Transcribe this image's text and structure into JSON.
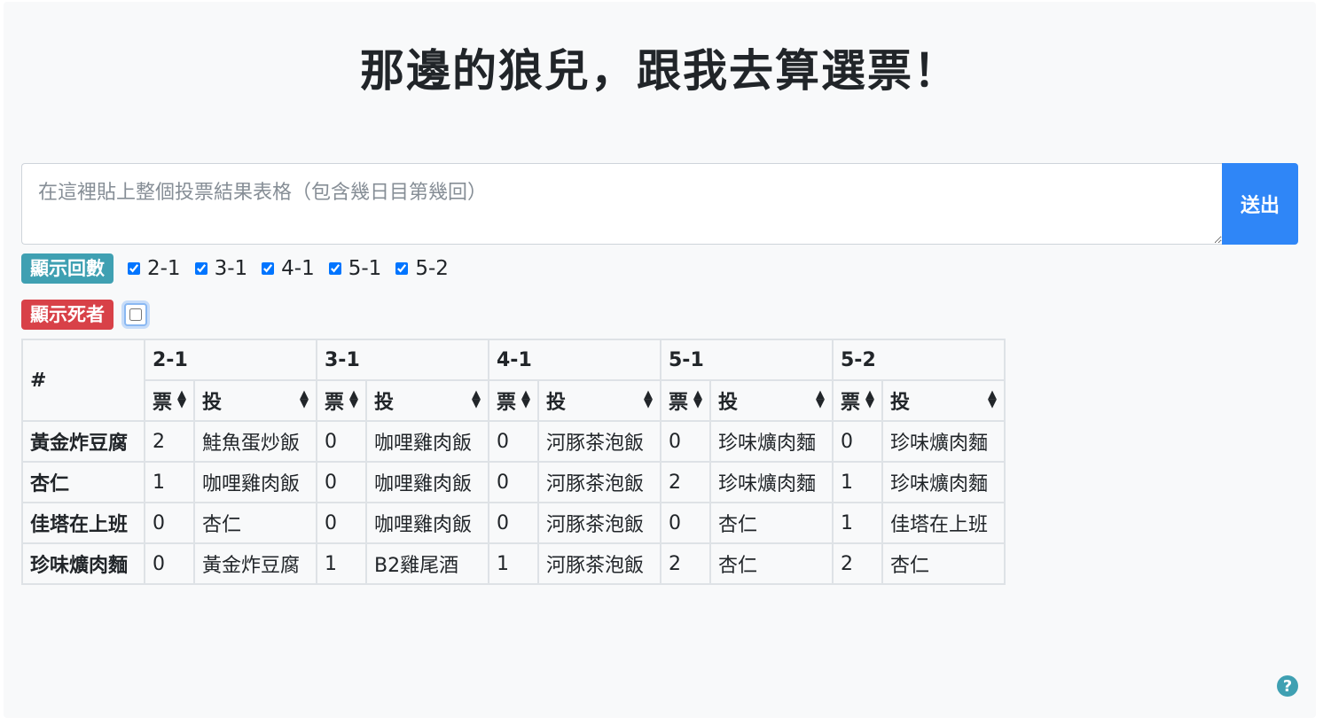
{
  "header": {
    "title": "那邊的狼兒，跟我去算選票！"
  },
  "input": {
    "placeholder": "在這裡貼上整個投票結果表格（包含幾日目第幾回）",
    "value": "",
    "submit_label": "送出"
  },
  "filters": {
    "rounds_label": "顯示回數",
    "rounds": [
      {
        "label": "2-1",
        "checked": true
      },
      {
        "label": "3-1",
        "checked": true
      },
      {
        "label": "4-1",
        "checked": true
      },
      {
        "label": "5-1",
        "checked": true
      },
      {
        "label": "5-2",
        "checked": true
      }
    ],
    "dead_label": "顯示死者",
    "dead_checked": false
  },
  "table": {
    "corner_header": "#",
    "rounds": [
      "2-1",
      "3-1",
      "4-1",
      "5-1",
      "5-2"
    ],
    "sub_headers": {
      "tickets": "票",
      "vote": "投"
    },
    "rows": [
      {
        "name": "黃金炸豆腐",
        "cells": [
          [
            "2",
            "鮭魚蛋炒飯"
          ],
          [
            "0",
            "咖哩雞肉飯"
          ],
          [
            "0",
            "河豚茶泡飯"
          ],
          [
            "0",
            "珍味爌肉麵"
          ],
          [
            "0",
            "珍味爌肉麵"
          ]
        ]
      },
      {
        "name": "杏仁",
        "cells": [
          [
            "1",
            "咖哩雞肉飯"
          ],
          [
            "0",
            "咖哩雞肉飯"
          ],
          [
            "0",
            "河豚茶泡飯"
          ],
          [
            "2",
            "珍味爌肉麵"
          ],
          [
            "1",
            "珍味爌肉麵"
          ]
        ]
      },
      {
        "name": "佳塔在上班",
        "cells": [
          [
            "0",
            "杏仁"
          ],
          [
            "0",
            "咖哩雞肉飯"
          ],
          [
            "0",
            "河豚茶泡飯"
          ],
          [
            "0",
            "杏仁"
          ],
          [
            "1",
            "佳塔在上班"
          ]
        ]
      },
      {
        "name": "珍味爌肉麵",
        "cells": [
          [
            "0",
            "黃金炸豆腐"
          ],
          [
            "1",
            "B2雞尾酒"
          ],
          [
            "1",
            "河豚茶泡飯"
          ],
          [
            "2",
            "杏仁"
          ],
          [
            "2",
            "杏仁"
          ]
        ]
      }
    ]
  },
  "help": {
    "icon": "question-circle-icon",
    "glyph": "?"
  },
  "colors": {
    "primary": "#2f86f7",
    "info": "#3fa0b2",
    "danger": "#d84148"
  }
}
